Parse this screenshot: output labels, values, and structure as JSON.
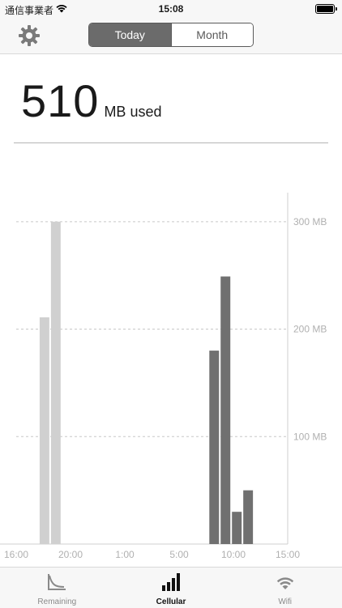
{
  "status_bar": {
    "carrier": "通信事業者",
    "time": "15:08",
    "wifi_icon": "wifi-icon",
    "battery_icon": "battery-icon"
  },
  "nav": {
    "settings_icon": "gear-icon",
    "segments": [
      {
        "label": "Today",
        "selected": true
      },
      {
        "label": "Month",
        "selected": false
      }
    ]
  },
  "usage": {
    "value": "510",
    "unit": "MB used"
  },
  "chart_data": {
    "type": "bar",
    "x_tick_labels": [
      "16:00",
      "20:00",
      "1:00",
      "5:00",
      "10:00",
      "15:00"
    ],
    "y_tick_labels": [
      "100 MB",
      "200 MB",
      "300 MB"
    ],
    "y_ticks": [
      100,
      200,
      300
    ],
    "ylim": [
      0,
      330
    ],
    "grid": true,
    "x_range_hours": [
      0,
      24
    ],
    "bars": [
      {
        "x": 2.5,
        "value": 211,
        "period": "previous"
      },
      {
        "x": 3.5,
        "value": 300,
        "period": "previous"
      },
      {
        "x": 17.5,
        "value": 180,
        "period": "current"
      },
      {
        "x": 18.5,
        "value": 249,
        "period": "current"
      },
      {
        "x": 19.5,
        "value": 30,
        "period": "current"
      },
      {
        "x": 20.5,
        "value": 50,
        "period": "current"
      }
    ],
    "colors": {
      "previous": "#d0d0d0",
      "current": "#707070",
      "grid": "#c8c8c8",
      "axis": "#cfcfcf",
      "label": "#b0b0b0"
    }
  },
  "tabs": [
    {
      "label": "Remaining",
      "icon": "remaining-chart-icon",
      "active": false
    },
    {
      "label": "Cellular",
      "icon": "cellular-signal-icon",
      "active": true
    },
    {
      "label": "Wifi",
      "icon": "wifi-icon",
      "active": false
    }
  ]
}
